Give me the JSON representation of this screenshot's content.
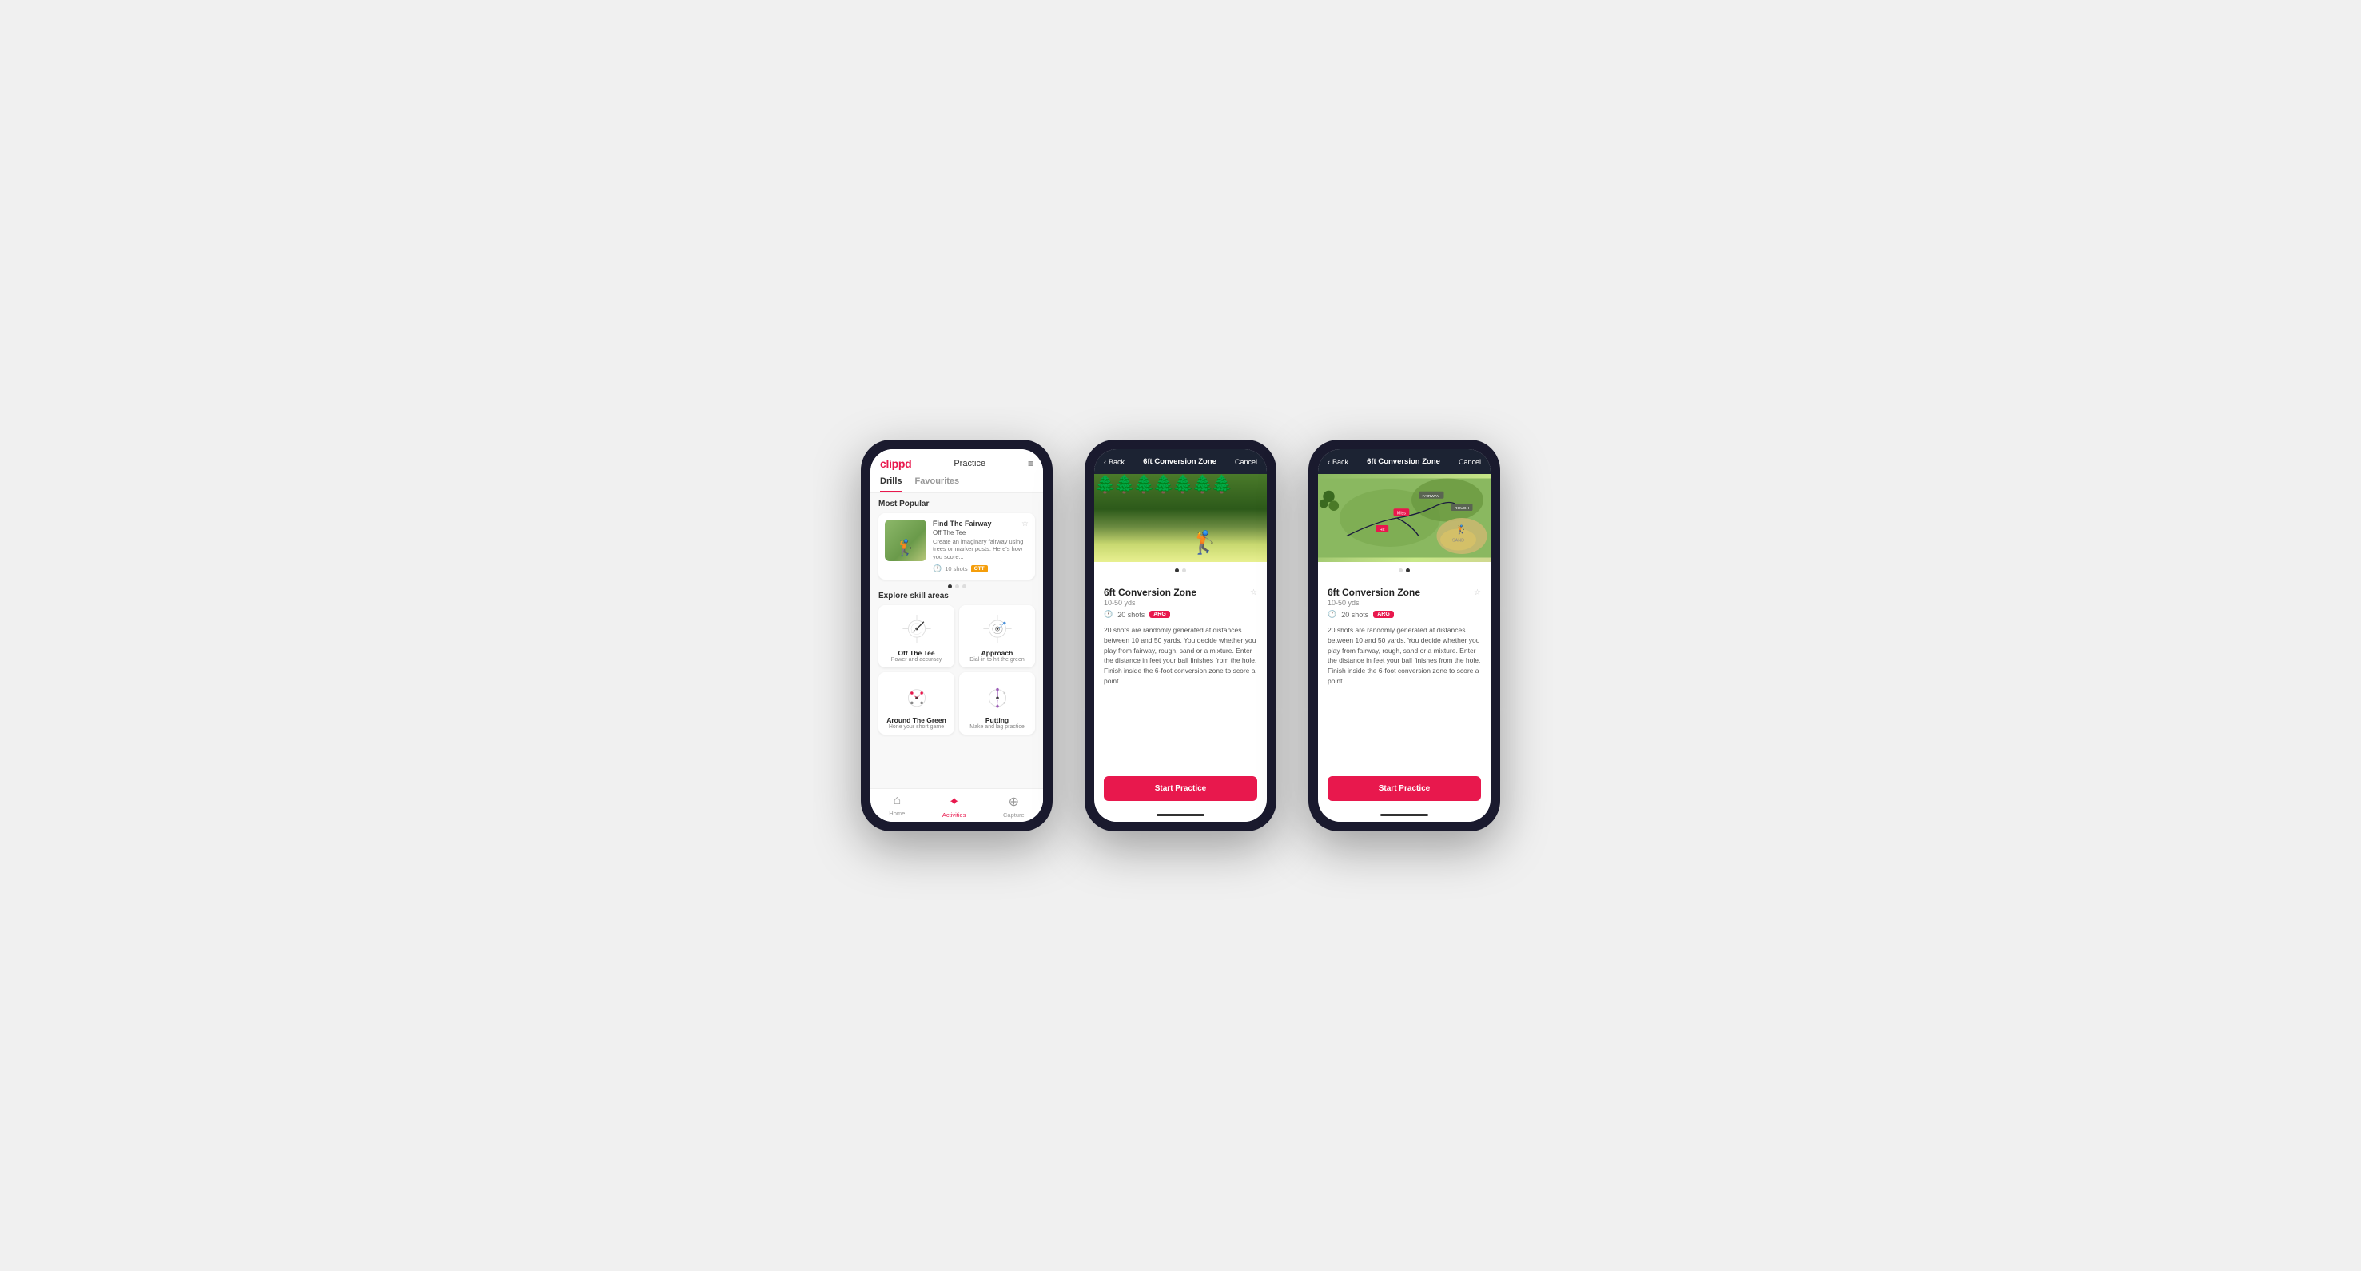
{
  "phone1": {
    "header": {
      "logo": "clippd",
      "title": "Practice",
      "menu_icon": "≡"
    },
    "tabs": [
      {
        "label": "Drills",
        "active": true
      },
      {
        "label": "Favourites",
        "active": false
      }
    ],
    "most_popular": {
      "section_title": "Most Popular",
      "card": {
        "name": "Find The Fairway",
        "sub": "Off The Tee",
        "desc": "Create an imaginary fairway using trees or marker posts. Here's how you score...",
        "shots": "10 shots",
        "tag": "OTT"
      }
    },
    "skill_areas": {
      "section_title": "Explore skill areas",
      "items": [
        {
          "name": "Off The Tee",
          "desc": "Power and accuracy"
        },
        {
          "name": "Approach",
          "desc": "Dial-in to hit the green"
        },
        {
          "name": "Around The Green",
          "desc": "Hone your short game"
        },
        {
          "name": "Putting",
          "desc": "Make and lag practice"
        }
      ]
    },
    "nav": {
      "items": [
        {
          "label": "Home",
          "icon": "⌂",
          "active": false
        },
        {
          "label": "Activities",
          "icon": "✦",
          "active": true
        },
        {
          "label": "Capture",
          "icon": "⊕",
          "active": false
        }
      ]
    }
  },
  "phone2": {
    "header": {
      "back": "Back",
      "title": "6ft Conversion Zone",
      "cancel": "Cancel"
    },
    "drill": {
      "name": "6ft Conversion Zone",
      "yardage": "10-50 yds",
      "shots": "20 shots",
      "tag": "ARG",
      "desc": "20 shots are randomly generated at distances between 10 and 50 yards. You decide whether you play from fairway, rough, sand or a mixture. Enter the distance in feet your ball finishes from the hole. Finish inside the 6-foot conversion zone to score a point."
    },
    "start_btn": "Start Practice"
  },
  "phone3": {
    "header": {
      "back": "Back",
      "title": "6ft Conversion Zone",
      "cancel": "Cancel"
    },
    "drill": {
      "name": "6ft Conversion Zone",
      "yardage": "10-50 yds",
      "shots": "20 shots",
      "tag": "ARG",
      "desc": "20 shots are randomly generated at distances between 10 and 50 yards. You decide whether you play from fairway, rough, sand or a mixture. Enter the distance in feet your ball finishes from the hole. Finish inside the 6-foot conversion zone to score a point."
    },
    "start_btn": "Start Practice",
    "map_labels": [
      "Fairway",
      "Rough",
      "Miss",
      "Hit",
      "Sand"
    ]
  }
}
